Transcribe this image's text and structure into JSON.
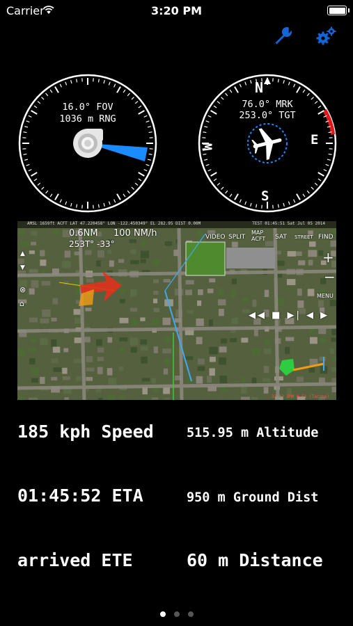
{
  "status_bar": {
    "carrier": "Carrier",
    "time": "3:20 PM",
    "battery_level": 1.0
  },
  "toolbar": {
    "wrench_icon": "wrench-icon",
    "settings_icon": "gears-icon",
    "accent_color": "#1565d8"
  },
  "camera_dial": {
    "fov_text": "16.0° FOV",
    "range_text": "1036 m RNG",
    "heading_color": "#1a8cff"
  },
  "compass_dial": {
    "mark_text": "76.0° MRK",
    "target_text": "253.0° TGT",
    "north": "N",
    "east": "E",
    "south": "S",
    "west": "W",
    "highlight_color": "#e0181c"
  },
  "map": {
    "header_left": "AMSL 1659ft ACFT LAT 47.220458° LON -122.450349° EL 282.95 DIST 0.00M",
    "header_right": "TEST 01:45:51 Sat Jul 05 2014",
    "distance": "0.6NM",
    "speed": "100 NM/h",
    "angles": "253T° -33°",
    "buttons": {
      "video": "VIDEO",
      "split": "SPLIT",
      "map_acft": "MAP ACFT",
      "sat": "SAT",
      "street": "STREET",
      "find": "FIND",
      "menu": "MENU"
    },
    "footer": "32.82 DMM 0.51 (Tacoma)"
  },
  "stats": {
    "speed": "185 kph Speed",
    "altitude": "515.95 m Altitude",
    "eta": "01:45:52 ETA",
    "ground_dist": "950 m Ground Dist",
    "ete": "arrived ETE",
    "distance": "60 m Distance"
  },
  "pager": {
    "current": 1,
    "total": 3
  }
}
